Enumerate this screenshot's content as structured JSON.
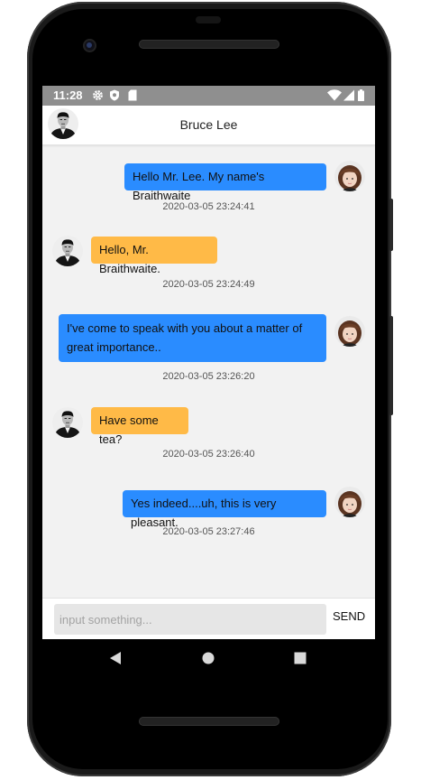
{
  "status_bar": {
    "time": "11:28",
    "icons_left": [
      "gear-icon",
      "shield-icon",
      "sd-card-icon"
    ],
    "icons_right": [
      "wifi-icon",
      "signal-icon",
      "battery-icon"
    ]
  },
  "header": {
    "title": "Bruce Lee",
    "avatar": "bruce-lee-avatar"
  },
  "messages": [
    {
      "side": "me",
      "text_lines": [
        "Hello Mr. Lee. My name's Braithwaite"
      ],
      "timestamp": "2020-03-05 23:24:41"
    },
    {
      "side": "them",
      "text_lines": [
        "Hello, Mr. Braithwaite."
      ],
      "timestamp": "2020-03-05 23:24:49"
    },
    {
      "side": "me",
      "text_lines": [
        "I've come to speak with you about a matter of",
        "great importance.."
      ],
      "timestamp": "2020-03-05 23:26:20"
    },
    {
      "side": "them",
      "text_lines": [
        "Have some tea?"
      ],
      "timestamp": "2020-03-05 23:26:40"
    },
    {
      "side": "me",
      "text_lines": [
        "Yes indeed....uh, this is very pleasant."
      ],
      "timestamp": "2020-03-05 23:27:46"
    }
  ],
  "composer": {
    "placeholder": "input something...",
    "value": "",
    "send_label": "SEND"
  },
  "colors": {
    "my_bubble": "#2a8cff",
    "their_bubble": "#ffba47",
    "chat_background": "#f2f2f2",
    "status_bar": "#8f8f8f"
  },
  "nav_bar": [
    "back-icon",
    "home-icon",
    "recents-icon"
  ]
}
